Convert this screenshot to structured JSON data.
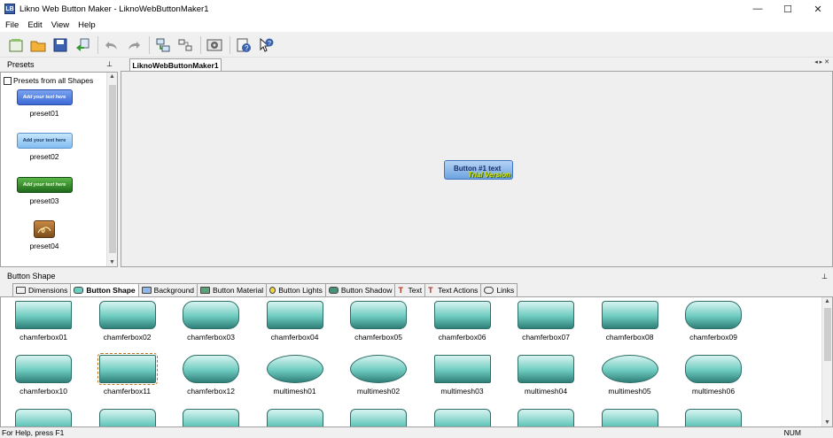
{
  "window": {
    "title": "Likno Web Button Maker - LiknoWebButtonMaker1",
    "app_icon_text": "LB",
    "minimize": "—",
    "maximize": "☐",
    "close": "✕"
  },
  "menu": [
    {
      "label": "File",
      "key": "F"
    },
    {
      "label": "Edit",
      "key": "E"
    },
    {
      "label": "View",
      "key": "V"
    },
    {
      "label": "Help",
      "key": "H"
    }
  ],
  "presets": {
    "title": "Presets",
    "checkbox_label": "Presets from all Shapes",
    "items": [
      {
        "label": "preset01",
        "text": "Add your text here",
        "color": "#4a7fe0"
      },
      {
        "label": "preset02",
        "text": "Add your text here",
        "color": "#8ec8f3"
      },
      {
        "label": "preset03",
        "text": "Add your text here",
        "color": "#2f8a2a"
      },
      {
        "label": "preset04",
        "text": "",
        "color": "#8a5a2a"
      }
    ]
  },
  "document": {
    "tab": "LiknoWebButtonMaker1",
    "nav": "◂ ▸ ✕",
    "button_text": "Button #1 text",
    "trial_text": "Trial Version"
  },
  "shape_pane": {
    "title": "Button Shape",
    "tabs": [
      "Dimensions",
      "Button Shape",
      "Background",
      "Button Material",
      "Button Lights",
      "Button Shadow",
      "Text",
      "Text Actions",
      "Links"
    ],
    "active_tab": "Button Shape",
    "shapes": [
      "chamferbox01",
      "chamferbox02",
      "chamferbox03",
      "chamferbox04",
      "chamferbox05",
      "chamferbox06",
      "chamferbox07",
      "chamferbox08",
      "chamferbox09",
      "chamferbox10",
      "chamferbox11",
      "chamferbox12",
      "multimesh01",
      "multimesh02",
      "multimesh03",
      "multimesh04",
      "multimesh05",
      "multimesh06"
    ],
    "selected_shape": "chamferbox11",
    "shape_color": "#6ecbc0"
  },
  "status": {
    "help": "For Help, press F1",
    "num": "NUM"
  },
  "icons": {
    "toolbar": [
      "new-icon",
      "open-icon",
      "save-icon",
      "export-icon",
      "undo-icon",
      "redo-icon",
      "generate-icon",
      "publish-icon",
      "settings-icon",
      "help-icon",
      "context-help-icon"
    ]
  }
}
